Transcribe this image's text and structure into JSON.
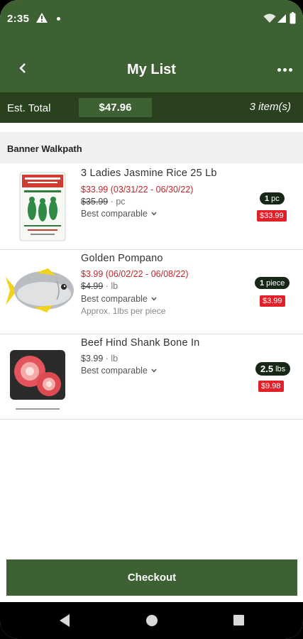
{
  "status_bar": {
    "time": "2:35"
  },
  "app_bar": {
    "title": "My List"
  },
  "summary": {
    "total_label": "Est. Total",
    "total_value": "$47.96",
    "item_count": "3 item(s)"
  },
  "section": {
    "title": "Banner Walkpath"
  },
  "items": [
    {
      "name": "3 Ladies Jasmine Rice 25 Lb",
      "sale_price": "$33.99",
      "sale_dates": "(03/31/22 - 06/30/22)",
      "reg_price": "$35.99",
      "reg_unit": "pc",
      "best_label": "Best comparable",
      "qty_value": "1",
      "qty_unit": "pc",
      "line_total": "$33.99"
    },
    {
      "name": "Golden Pompano",
      "sale_price": "$3.99",
      "sale_dates": "(06/02/22 - 06/08/22)",
      "reg_price": "$4.99",
      "reg_unit": "lb",
      "best_label": "Best comparable",
      "approx": "Approx. 1lbs per piece",
      "qty_value": "1",
      "qty_unit": "piece",
      "line_total": "$3.99"
    },
    {
      "name": "Beef Hind Shank Bone In",
      "price": "$3.99",
      "price_unit": "lb",
      "best_label": "Best comparable",
      "qty_value": "2.5",
      "qty_unit": "lbs",
      "line_total": "$9.98"
    }
  ],
  "checkout": {
    "label": "Checkout"
  },
  "colors": {
    "primary_green": "#3d6132",
    "dark_green": "#29411f",
    "sale_red": "#c0272d",
    "badge_red": "#e3202a",
    "badge_dark": "#162715"
  }
}
